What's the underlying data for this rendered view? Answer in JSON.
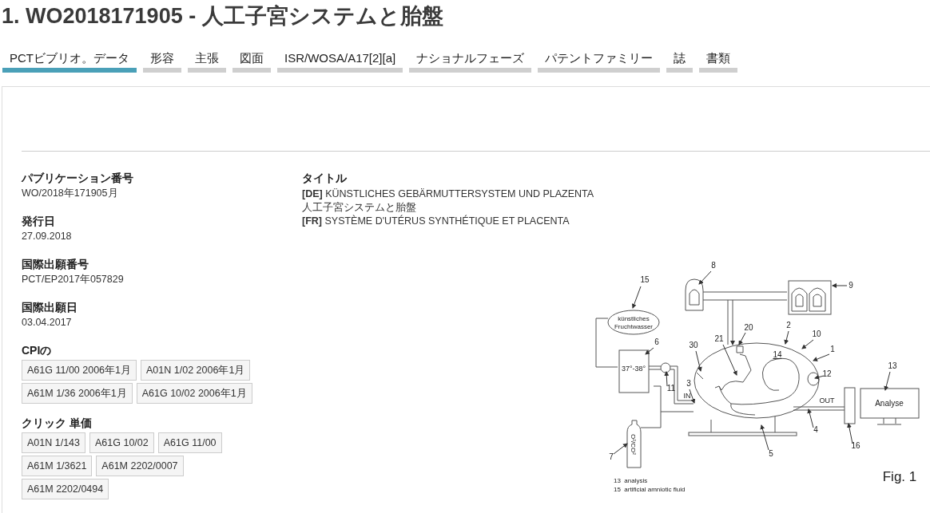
{
  "title": "1. WO2018171905 - 人工子宮システムと胎盤",
  "tabs": [
    {
      "label": "PCTビブリオ。データ",
      "selected": true
    },
    {
      "label": "形容",
      "selected": false
    },
    {
      "label": "主張",
      "selected": false
    },
    {
      "label": "図面",
      "selected": false
    },
    {
      "label": "ISR/WOSA/A17[2][a]",
      "selected": false
    },
    {
      "label": "ナショナルフェーズ",
      "selected": false
    },
    {
      "label": "パテントファミリー",
      "selected": false
    },
    {
      "label": "誌",
      "selected": false
    },
    {
      "label": "書類",
      "selected": false
    }
  ],
  "fields": [
    {
      "label": "パブリケーション番号",
      "value": "WO/2018年171905月"
    },
    {
      "label": "発行日",
      "value": "27.09.2018"
    },
    {
      "label": "国際出願番号",
      "value": "PCT/EP2017年057829"
    },
    {
      "label": "国際出願日",
      "value": "03.04.2017"
    }
  ],
  "tag_groups": [
    {
      "heading": "CPIの",
      "tags": [
        "A61G 11/00 2006年1月",
        "A01N 1/02 2006年1月",
        "A61M 1/36 2006年1月",
        "A61G 10/02 2006年1月"
      ]
    },
    {
      "heading": "クリック 単価",
      "tags": [
        "A01N 1/143",
        "A61G 10/02",
        "A61G 11/00",
        "A61M 1/3621",
        "A61M 2202/0007",
        "A61M 2202/0494"
      ]
    }
  ],
  "title_section": {
    "heading": "タイトル",
    "lines": [
      "**[DE]** KÜNSTLICHES GEBÄRMUTTERSYSTEM UND PLAZENTA",
      "人工子宮システムと胎盤",
      "**[FR]** SYSTÈME D'UTÉRUS SYNTHÉTIQUE ET PLACENTA"
    ]
  },
  "figure": {
    "reference_numbers": [
      "8",
      "9",
      "15",
      "6",
      "20",
      "21",
      "2",
      "10",
      "1",
      "30",
      "14",
      "12",
      "3",
      "11",
      "13",
      "4",
      "16",
      "5",
      "7"
    ],
    "fluid_label": [
      "künstliches",
      "Fruchtwasser"
    ],
    "temperature": "37°-38°",
    "inlet": "IN",
    "outlet": "OUT",
    "monitor_text": "Analyse",
    "gas_label": "O²/CO²",
    "legend": [
      "13  analysis",
      "15  artificial amniotic fluid"
    ],
    "caption": "Fig. 1"
  }
}
